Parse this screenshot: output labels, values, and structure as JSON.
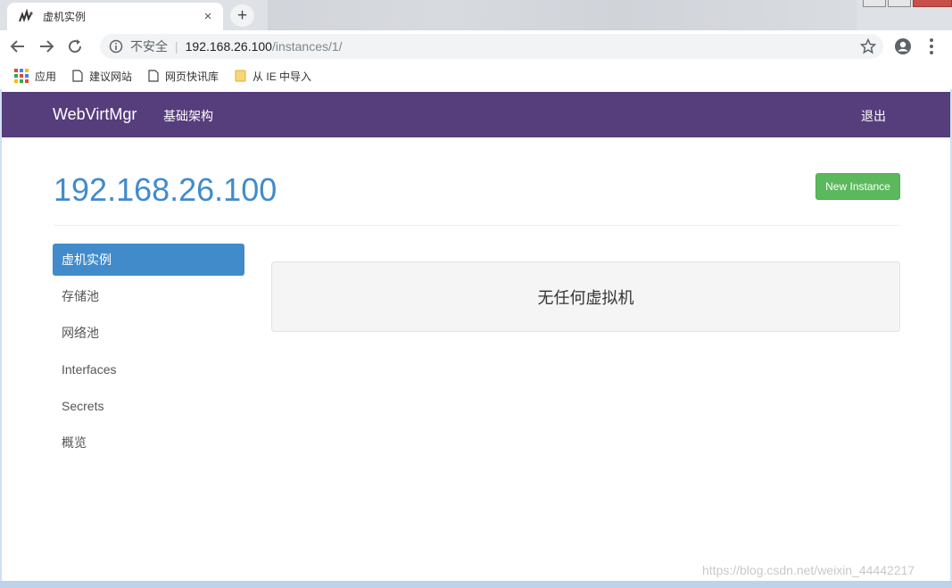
{
  "browser": {
    "tab": {
      "title": "虚机实例",
      "close_glyph": "×"
    },
    "new_tab_glyph": "+",
    "address": {
      "security_label": "不安全",
      "url_host": "192.168.26.100",
      "url_path": "/instances/1/"
    },
    "bookmarks": [
      {
        "label": "应用",
        "icon": "apps-grid-icon"
      },
      {
        "label": "建议网站",
        "icon": "page-icon"
      },
      {
        "label": "网页快讯库",
        "icon": "page-icon"
      },
      {
        "label": "从 IE 中导入",
        "icon": "folder-icon"
      }
    ]
  },
  "navbar": {
    "brand": "WebVirtMgr",
    "link": "基础架构",
    "logout": "退出",
    "color": "#563d7c"
  },
  "header": {
    "title": "192.168.26.100",
    "new_instance": "New Instance"
  },
  "sidebar": {
    "items": [
      {
        "label": "虚机实例",
        "active": true
      },
      {
        "label": "存储池",
        "active": false
      },
      {
        "label": "网络池",
        "active": false
      },
      {
        "label": "Interfaces",
        "active": false
      },
      {
        "label": "Secrets",
        "active": false
      },
      {
        "label": "概览",
        "active": false
      }
    ]
  },
  "main": {
    "empty_message": "无任何虚拟机"
  },
  "watermark": "https://blog.csdn.net/weixin_44442217",
  "colors": {
    "primary": "#428bca",
    "success": "#5cb85c"
  }
}
